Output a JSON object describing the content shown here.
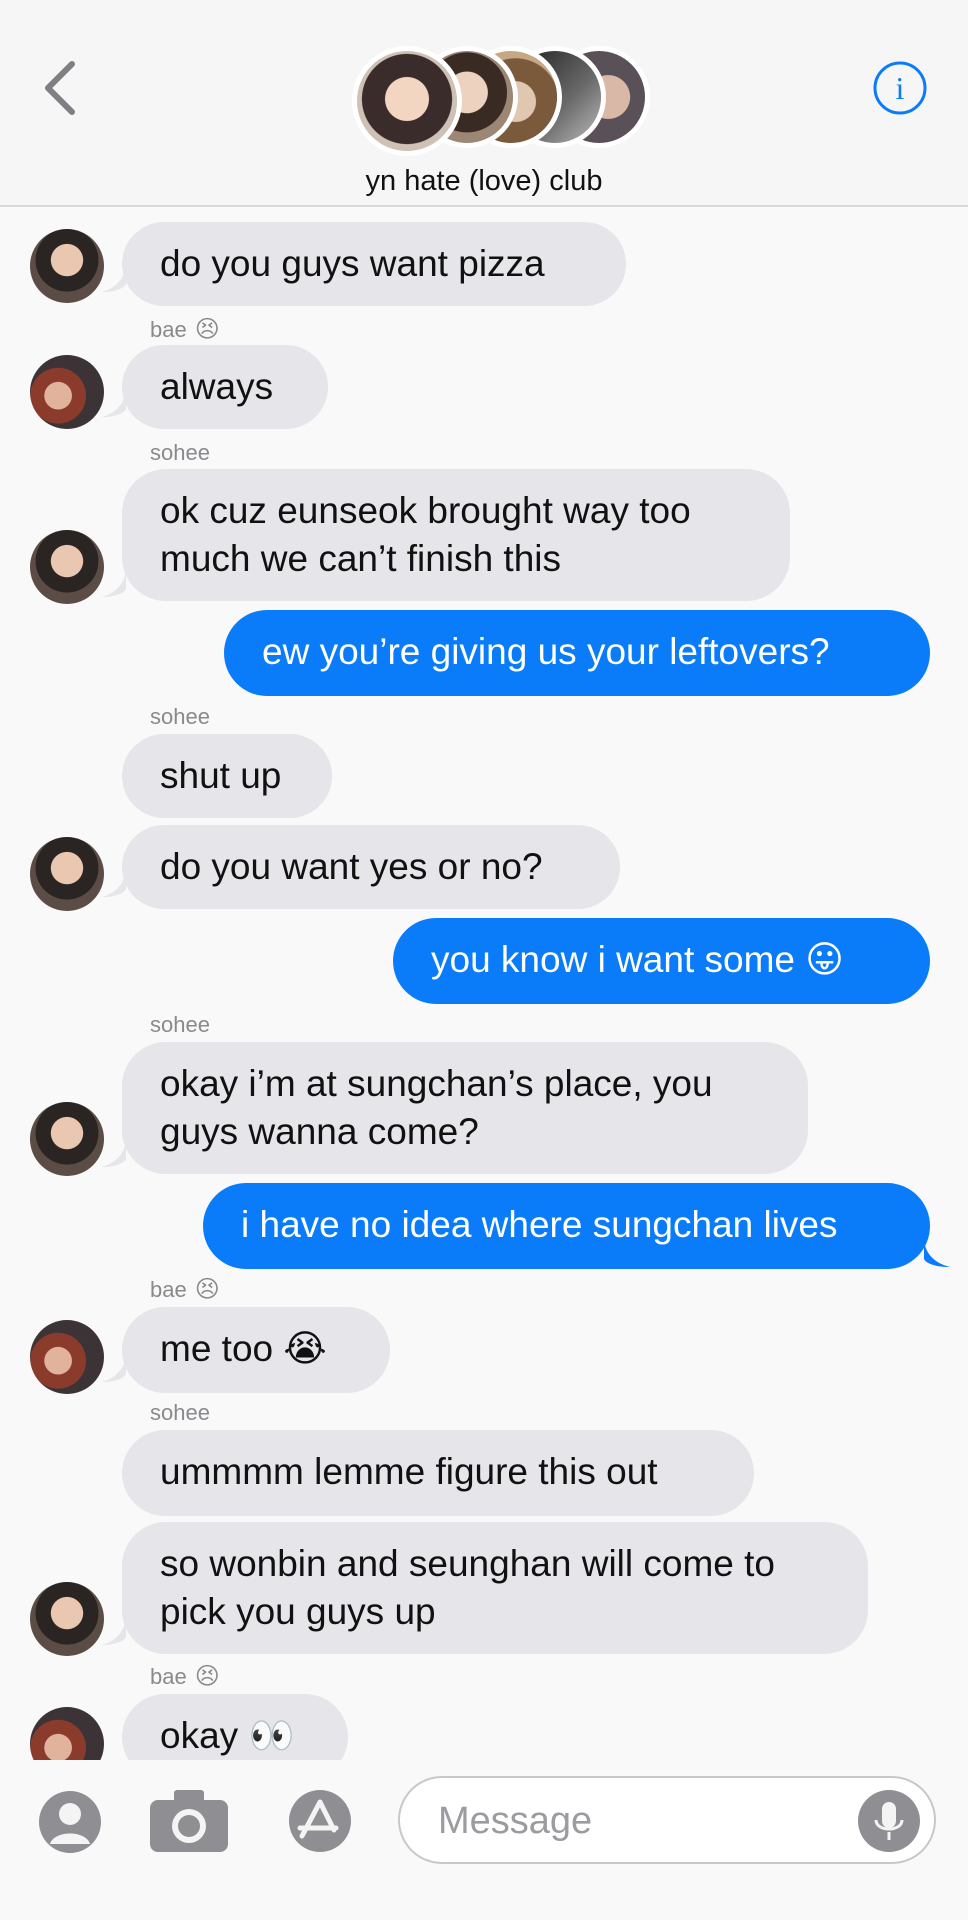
{
  "header": {
    "title": "yn hate (love) club",
    "info_icon_letter": "i"
  },
  "messages": [
    {
      "side": "in",
      "text": "do you guys want pizza"
    },
    {
      "sender": "bae",
      "sender_emoji": "😣"
    },
    {
      "side": "in",
      "text": "always"
    },
    {
      "sender": "sohee"
    },
    {
      "side": "in",
      "lines": [
        "ok cuz eunseok brought way too",
        "much we can’t finish this"
      ]
    },
    {
      "side": "out",
      "text": "ew you’re giving us your leftovers?"
    },
    {
      "sender": "sohee"
    },
    {
      "side": "in",
      "text": "shut up"
    },
    {
      "side": "in",
      "text": "do you want yes or no?"
    },
    {
      "side": "out",
      "text": "you know i want some",
      "emoji": "😛"
    },
    {
      "sender": "sohee"
    },
    {
      "side": "in",
      "lines": [
        "okay i’m at sungchan’s place, you",
        "guys wanna come?"
      ]
    },
    {
      "side": "out",
      "text": "i have no idea where sungchan lives"
    },
    {
      "sender": "bae",
      "sender_emoji": "😣"
    },
    {
      "side": "in",
      "text": "me too",
      "emoji": "😭"
    },
    {
      "sender": "sohee"
    },
    {
      "side": "in",
      "text": "ummmm lemme figure this out"
    },
    {
      "side": "in",
      "lines": [
        "so wonbin and seunghan will come to",
        "pick you guys up"
      ]
    },
    {
      "sender": "bae",
      "sender_emoji": "😣"
    },
    {
      "side": "in",
      "text": "okay",
      "emoji": "👀"
    }
  ],
  "composer": {
    "placeholder": "Message"
  },
  "colors": {
    "outgoing": "#0a7cf9",
    "incoming": "#e5e5ea",
    "accent": "#0a7cf9"
  },
  "icons": [
    "back-chevron-icon",
    "info-icon",
    "contact-icon",
    "camera-icon",
    "app-store-icon",
    "microphone-icon"
  ]
}
